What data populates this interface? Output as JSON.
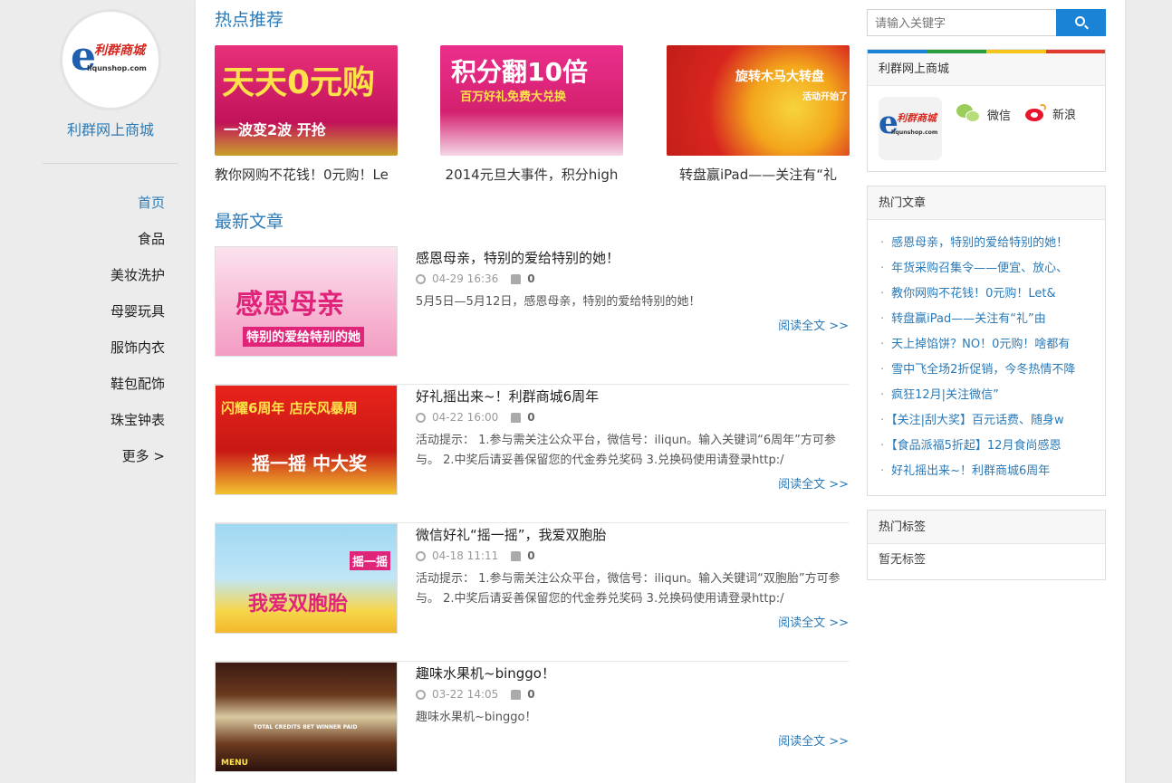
{
  "site": {
    "name": "利群网上商城",
    "logo_cn": "利群商城",
    "logo_url": "liqunshop.com"
  },
  "nav": {
    "items": [
      "首页",
      "食品",
      "美妆洗护",
      "母婴玩具",
      "服饰内衣",
      "鞋包配饰",
      "珠宝钟表",
      "更多 >"
    ]
  },
  "hot": {
    "title": "热点推荐",
    "items": [
      {
        "caption": "教你网购不花钱！0元购！Le",
        "img_text": "天天0元购",
        "img_sub": "一波变2波 开抢"
      },
      {
        "caption": "2014元旦大事件，积分high",
        "img_text": "积分翻10倍",
        "img_sub": "百万好礼免费大兑换"
      },
      {
        "caption": "转盘赢iPad——关注有“礼",
        "img_text": "旋转木马大转盘",
        "img_sub": "活动开始了"
      }
    ]
  },
  "latest": {
    "title": "最新文章",
    "more_label": "阅读全文 >>",
    "articles": [
      {
        "title": "感恩母亲，特别的爱给特别的她！",
        "date": "04-29 16:36",
        "likes": "0",
        "excerpt": "5月5日—5月12日，感恩母亲，特别的爱给特别的她！",
        "img_text": "感恩母亲",
        "img_sub": "特别的爱给特别的她"
      },
      {
        "title": "好礼摇出来~！利群商城6周年",
        "date": "04-22 16:00",
        "likes": "0",
        "excerpt": "活动提示： 1.参与需关注公众平台，微信号：iliqun。输入关键词“6周年”方可参与。 2.中奖后请妥善保留您的代金券兑奖码 3.兑换码使用请登录http:/",
        "img_text": "闪耀6周年 店庆风暴周",
        "img_sub": "摇一摇 中大奖"
      },
      {
        "title": "微信好礼“摇一摇”，我爱双胞胎",
        "date": "04-18 11:11",
        "likes": "0",
        "excerpt": "活动提示： 1.参与需关注公众平台，微信号：iliqun。输入关键词“双胞胎”方可参与。 2.中奖后请妥善保留您的代金券兑奖码 3.兑换码使用请登录http:/",
        "img_text": "我爱双胞胎",
        "img_sub": "摇一摇"
      },
      {
        "title": "趣味水果机~binggo！",
        "date": "03-22 14:05",
        "likes": "0",
        "excerpt": "趣味水果机~binggo！",
        "img_text": "TOTAL CREDITS  BET  WINNER PAID",
        "img_sub": "MENU"
      }
    ]
  },
  "search": {
    "placeholder": "请输入关键字"
  },
  "sidebar": {
    "profile": {
      "title": "利群网上商城",
      "wechat_label": "微信",
      "weibo_label": "新浪"
    },
    "hot_articles": {
      "title": "热门文章",
      "items": [
        "感恩母亲，特别的爱给特别的她！",
        "年货采购召集令——便宜、放心、",
        "教你网购不花钱！0元购！Let&",
        "转盘赢iPad——关注有“礼”由",
        "天上掉馅饼？NO！0元购！啥都有",
        "雪中飞全场2折促销，今冬热情不降",
        "疯狂12月|关注微信”",
        "【关注|刮大奖】百元话费、随身w",
        "【食品派福5折起】12月食尚感恩",
        "好礼摇出来~！利群商城6周年"
      ]
    },
    "hot_tags": {
      "title": "热门标签",
      "empty": "暂无标签"
    }
  },
  "colors": {
    "accent": "#2a7ab8",
    "search_button": "#1b83d6"
  }
}
